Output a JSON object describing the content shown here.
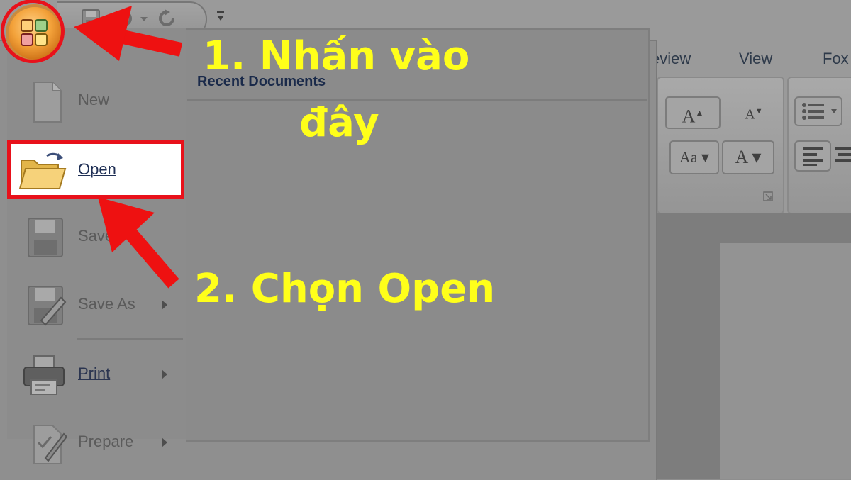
{
  "qat": {
    "more": "▾"
  },
  "ribbon": {
    "tabs": [
      "eview",
      "View",
      "Fox"
    ],
    "buttons": {
      "grow_font": "A",
      "shrink_font": "A",
      "change_case": "Aa",
      "font_color": "A"
    }
  },
  "menu": {
    "recent_header": "Recent Documents",
    "items": [
      {
        "label": "New",
        "access_key_index": 0,
        "enabled": false
      },
      {
        "label": "Open",
        "access_key_index": 0,
        "enabled": true
      },
      {
        "label": "Save",
        "access_key_index": 2,
        "enabled": false
      },
      {
        "label": "Save As",
        "access_key_index": 5,
        "enabled": false
      },
      {
        "label": "Print",
        "access_key_index": 0,
        "enabled": true
      },
      {
        "label": "Prepare",
        "access_key_index": 2,
        "enabled": false
      }
    ],
    "open_label": "Open"
  },
  "annotations": {
    "step1_line1": "1. Nhấn vào",
    "step1_line2": "đây",
    "step2": "2. Chọn Open",
    "highlight_color": "#e8111b",
    "text_color": "#ffff1a"
  }
}
